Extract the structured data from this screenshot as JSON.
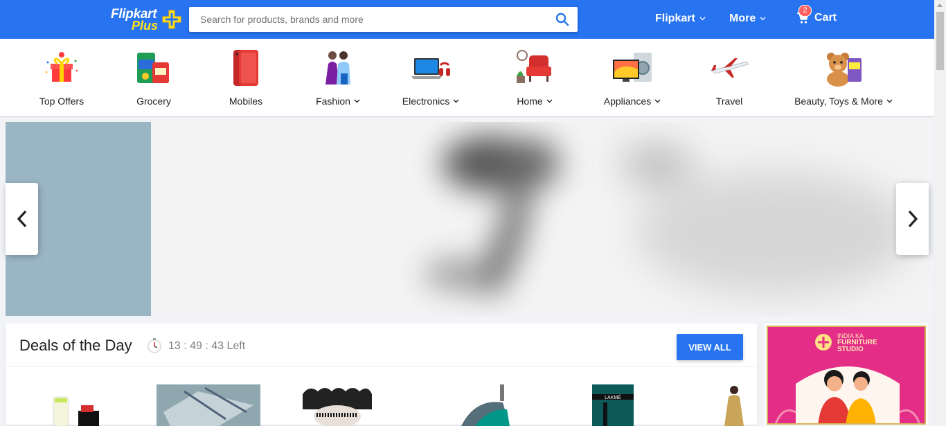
{
  "header": {
    "logo_word1": "Flipkart",
    "logo_word2": "Plus",
    "search_placeholder": "Search for products, brands and more",
    "nav_account": "Flipkart",
    "nav_more": "More",
    "cart_label": "Cart",
    "cart_count": "2",
    "brand_color": "#2874f0",
    "logo_accent": "#ffe11b"
  },
  "categories": [
    {
      "label": "Top Offers",
      "icon": "gift-icon"
    },
    {
      "label": "Grocery",
      "icon": "grocery-icon"
    },
    {
      "label": "Mobiles",
      "icon": "mobile-icon"
    },
    {
      "label": "Fashion",
      "icon": "fashion-icon",
      "dropdown": true
    },
    {
      "label": "Electronics",
      "icon": "laptop-icon",
      "dropdown": true
    },
    {
      "label": "Home",
      "icon": "armchair-icon",
      "dropdown": true
    },
    {
      "label": "Appliances",
      "icon": "appliances-icon",
      "dropdown": true
    },
    {
      "label": "Travel",
      "icon": "airplane-icon"
    },
    {
      "label": "Beauty, Toys & More",
      "icon": "teddy-bear-icon",
      "dropdown": true
    }
  ],
  "deals": {
    "title": "Deals of the Day",
    "timer": "13 : 49 : 43 Left",
    "view_all": "VIEW ALL"
  },
  "ad": {
    "line1": "INDIA KA",
    "line2": "FURNITURE",
    "line3": "STUDIO"
  }
}
